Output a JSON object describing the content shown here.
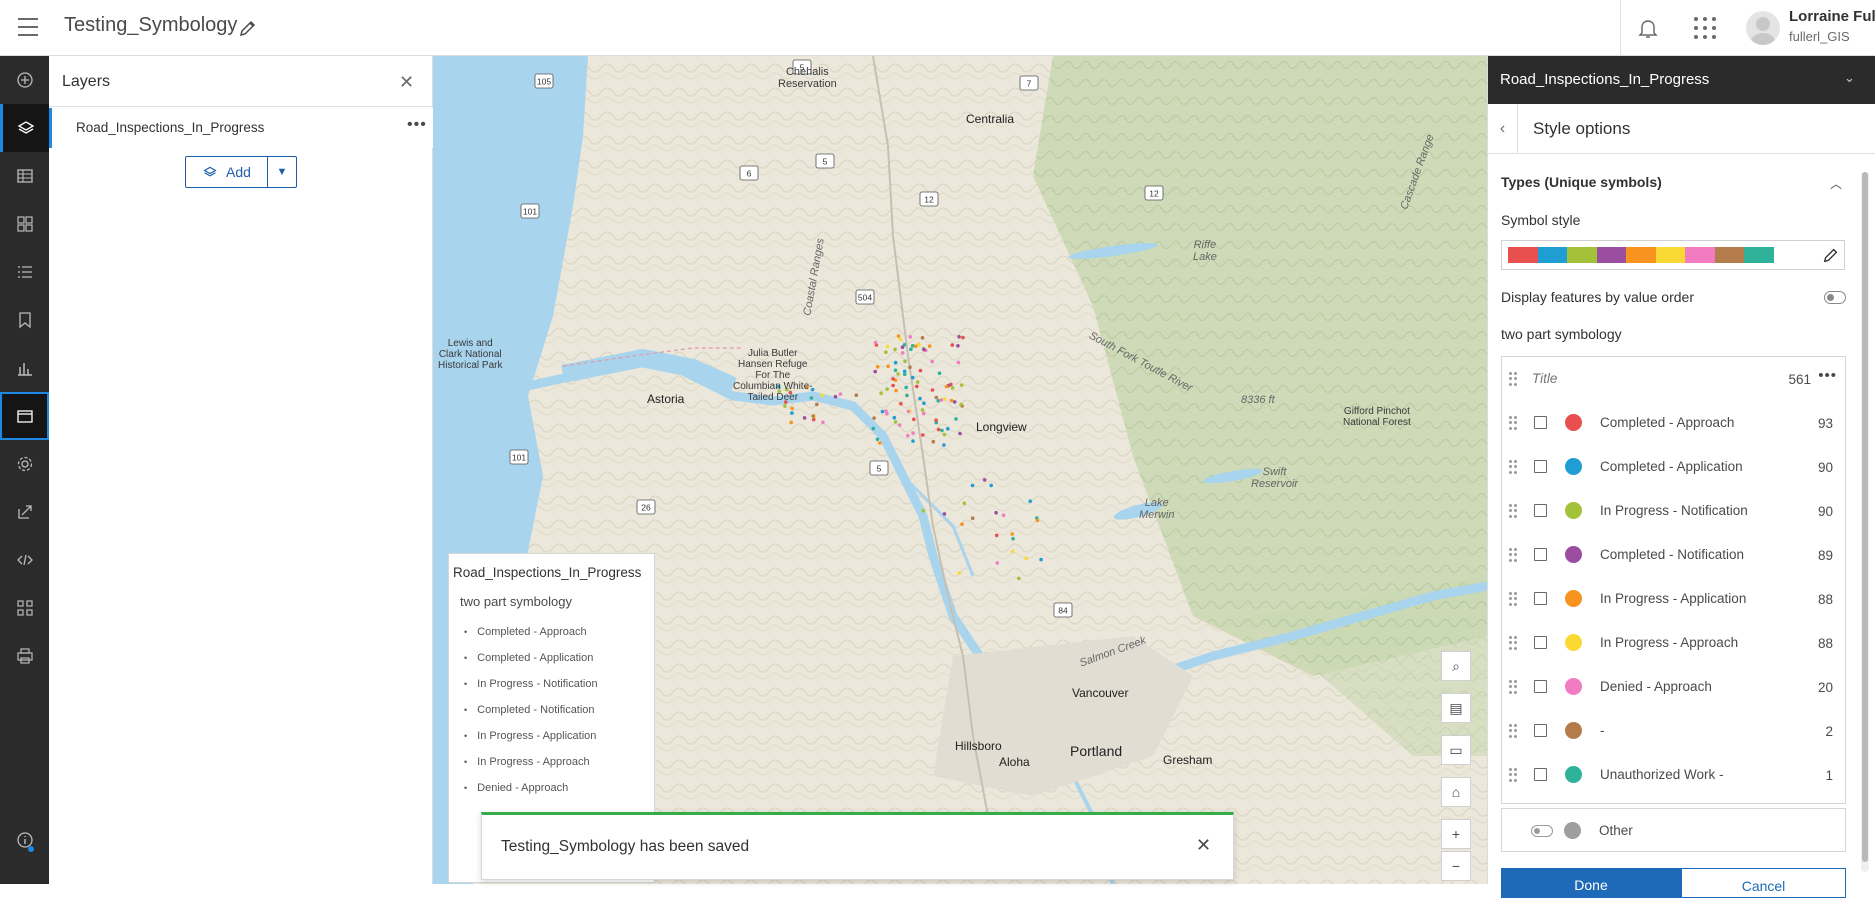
{
  "header": {
    "app_title": "Testing_Symbology",
    "user_name": "Lorraine Full",
    "user_id": "fullerl_GIS"
  },
  "icons": {
    "menu": "hamburger-icon",
    "edit": "pencil-icon",
    "notifications": "bell-icon",
    "apps": "app-launcher-icon"
  },
  "layers_panel": {
    "title": "Layers",
    "layer_name": "Road_Inspections_In_Progress",
    "add_label": "Add"
  },
  "map": {
    "labels": {
      "chehalis": "Chehalis\nReservation",
      "centralia": "Centralia",
      "coastal_ranges": "Coastal Ranges",
      "riffe": "Riffe\nLake",
      "lewis_clark": "Lewis and\nClark National\nHistorical Park",
      "julia_butler": "Julia Butler\nHansen Refuge\nFor The\nColumbian White-\nTailed Deer",
      "astoria": "Astoria",
      "longview": "Longview",
      "gifford": "Gifford Pinchot\nNational Forest",
      "swift": "Swift\nReservoir",
      "lake_merwin": "Lake\nMerwin",
      "vancouver": "Vancouver",
      "hillsboro": "Hillsboro",
      "aloha": "Aloha",
      "portland": "Portland",
      "gresham": "Gresham",
      "cascade_range": "Cascade Range",
      "elevation": "8336 ft",
      "salmon_creek": "Salmon Creek",
      "south_fork": "South Fork Toutle River"
    },
    "shields": [
      "105",
      "5",
      "7",
      "6",
      "5",
      "12",
      "12",
      "101",
      "504",
      "101",
      "5",
      "26",
      "84"
    ]
  },
  "legend": {
    "title": "Road_Inspections_In_Progress",
    "subtitle": "two part symbology",
    "items": [
      "Completed - Approach",
      "Completed - Application",
      "In Progress - Notification",
      "Completed - Notification",
      "In Progress - Application",
      "In Progress - Approach",
      "Denied - Approach"
    ]
  },
  "toast": {
    "message": "Testing_Symbology has been saved"
  },
  "style_panel": {
    "layer_title": "Road_Inspections_In_Progress",
    "subtitle": "Style options",
    "section_title": "Types (Unique symbols)",
    "symbol_style_label": "Symbol style",
    "ramp_colors": [
      "#e8504f",
      "#1f9ed3",
      "#a3c23a",
      "#9b4ea0",
      "#f7931e",
      "#fbd935",
      "#f17cc2",
      "#b47c4a",
      "#2eb29a"
    ],
    "order_label": "Display features by value order",
    "group_label": "two part symbology",
    "title_placeholder": "Title",
    "total_count": "561",
    "categories": [
      {
        "label": "Completed - Approach",
        "count": "93",
        "color": "#e8504f"
      },
      {
        "label": "Completed - Application",
        "count": "90",
        "color": "#1f9ed3"
      },
      {
        "label": "In Progress - Notification",
        "count": "90",
        "color": "#a3c23a"
      },
      {
        "label": "Completed - Notification",
        "count": "89",
        "color": "#9b4ea0"
      },
      {
        "label": "In Progress - Application",
        "count": "88",
        "color": "#f7931e"
      },
      {
        "label": "In Progress - Approach",
        "count": "88",
        "color": "#fbd935"
      },
      {
        "label": "Denied - Approach",
        "count": "20",
        "color": "#f17cc2"
      },
      {
        "label": "-",
        "count": "2",
        "color": "#b47c4a"
      },
      {
        "label": "Unauthorized Work -",
        "count": "1",
        "color": "#2eb29a"
      }
    ],
    "other_label": "Other",
    "done_label": "Done",
    "cancel_label": "Cancel"
  }
}
